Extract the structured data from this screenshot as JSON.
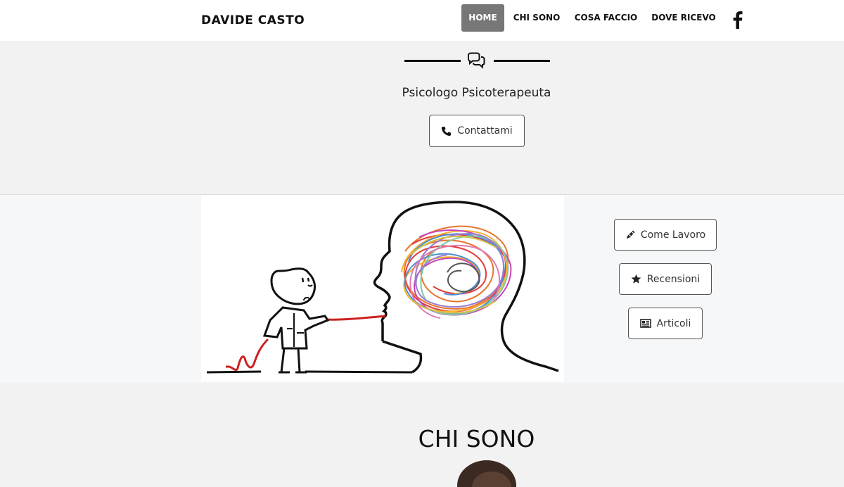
{
  "brand": "DAVIDE CASTO",
  "nav": {
    "home": "HOME",
    "chi_sono": "CHI SONO",
    "cosa_faccio": "COSA FACCIO",
    "dove_ricevo": "DOVE RICEVO",
    "social_icon": "facebook-icon"
  },
  "hero": {
    "icon": "comments-icon",
    "subtitle": "Psicologo Psicoterapeuta",
    "contact_button": "Contattami",
    "contact_icon": "phone-icon"
  },
  "side_buttons": [
    {
      "label": "Come Lavoro",
      "icon": "pen-icon"
    },
    {
      "label": "Recensioni",
      "icon": "star-icon"
    },
    {
      "label": "Articoli",
      "icon": "newspaper-icon"
    }
  ],
  "section": {
    "chi_sono_title": "CHI SONO"
  },
  "colors": {
    "active_nav": "#777777",
    "page_bg": "#f2f2f2",
    "accent_red": "#cc2222"
  }
}
